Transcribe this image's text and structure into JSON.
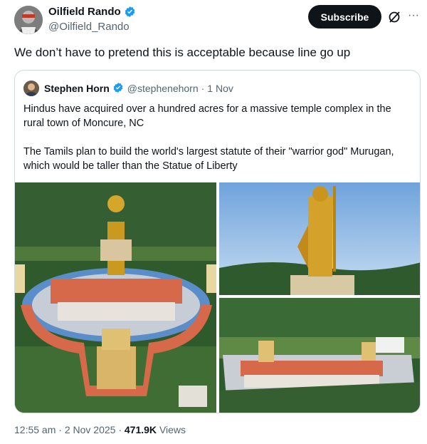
{
  "author": {
    "display_name": "Oilfield Rando",
    "handle": "@Oilfield_Rando",
    "verified": true
  },
  "actions": {
    "subscribe_label": "Subscribe",
    "more_label": "···"
  },
  "tweet": {
    "text": "We don’t have to pretend this is acceptable because line go up"
  },
  "quoted": {
    "display_name": "Stephen Horn",
    "handle": "@stephenehorn",
    "separator": "·",
    "date": "1 Nov",
    "paragraph1": "Hindus have acquired over a hundred acres for a massive temple complex in the rural town of Moncure, NC",
    "paragraph2": "The Tamils plan to build the world's largest statute of their \"warrior god\" Murugan, which would be taller than the Statue of Liberty"
  },
  "meta": {
    "time": "12:55 am",
    "separator": "·",
    "date": "2 Nov 2025",
    "views_count": "471.9K",
    "views_label": "Views"
  },
  "colors": {
    "verified_blue": "#1d9bf0",
    "text_secondary": "#536471",
    "border": "#cfd9de"
  },
  "icons": [
    "verified-badge-icon",
    "grok-icon",
    "more-icon"
  ]
}
